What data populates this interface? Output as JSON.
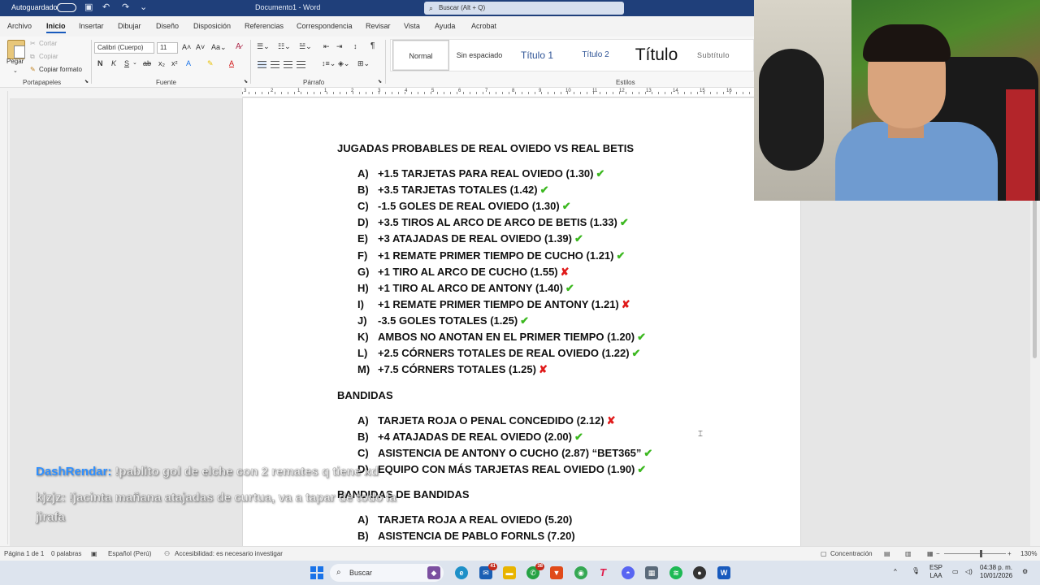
{
  "titlebar": {
    "autosave": "Autoguardado",
    "document_title": "Documento1 - Word",
    "search_placeholder": "Buscar (Alt + Q)"
  },
  "menu": {
    "tabs": [
      "Archivo",
      "Inicio",
      "Insertar",
      "Dibujar",
      "Diseño",
      "Disposición",
      "Referencias",
      "Correspondencia",
      "Revisar",
      "Vista",
      "Ayuda",
      "Acrobat"
    ],
    "active": "Inicio"
  },
  "ribbon": {
    "clipboard": {
      "paste": "Pegar",
      "cut": "Cortar",
      "copy": "Copiar",
      "format_painter": "Copiar formato",
      "label": "Portapapeles"
    },
    "font": {
      "name": "Calibri (Cuerpo)",
      "size": "11",
      "label": "Fuente"
    },
    "paragraph": {
      "label": "Párrafo"
    },
    "styles": {
      "label": "Estilos",
      "items": [
        "Normal",
        "Sin espaciado",
        "Título 1",
        "Título 2",
        "Título",
        "Subtítulo"
      ]
    }
  },
  "ruler": {
    "numbers": [
      "3",
      "2",
      "1",
      "1",
      "2",
      "3",
      "4",
      "5",
      "6",
      "7",
      "8",
      "9",
      "10",
      "11",
      "12",
      "13",
      "14",
      "15",
      "16"
    ]
  },
  "document": {
    "heading1": "JUGADAS PROBABLES DE REAL OVIEDO VS REAL BETIS",
    "list1": [
      {
        "letter": "A)",
        "text": "+1.5 TARJETAS PARA REAL OVIEDO (1.30)",
        "mark": "✔",
        "status": "ok"
      },
      {
        "letter": "B)",
        "text": "+3.5 TARJETAS TOTALES (1.42)",
        "mark": "✔",
        "status": "ok"
      },
      {
        "letter": "C)",
        "text": "-1.5 GOLES DE REAL OVIEDO (1.30)",
        "mark": "✔",
        "status": "ok"
      },
      {
        "letter": "D)",
        "text": "+3.5 TIROS AL ARCO DE ARCO DE BETIS (1.33)",
        "mark": "✔",
        "status": "ok"
      },
      {
        "letter": "E)",
        "text": "+3 ATAJADAS DE REAL OVIEDO (1.39)",
        "mark": "✔",
        "status": "ok"
      },
      {
        "letter": "F)",
        "text": "+1 REMATE PRIMER TIEMPO DE CUCHO (1.21)",
        "mark": "✔",
        "status": "ok"
      },
      {
        "letter": "G)",
        "text": "+1 TIRO AL ARCO DE CUCHO (1.55)",
        "mark": "✘",
        "status": "bad"
      },
      {
        "letter": "H)",
        "text": "+1 TIRO AL ARCO DE ANTONY (1.40)",
        "mark": "✔",
        "status": "ok"
      },
      {
        "letter": "I)",
        "text": "+1 REMATE PRIMER TIEMPO DE ANTONY (1.21)",
        "mark": "✘",
        "status": "bad"
      },
      {
        "letter": "J)",
        "text": "-3.5 GOLES TOTALES (1.25)",
        "mark": "✔",
        "status": "ok"
      },
      {
        "letter": "K)",
        "text": "AMBOS NO ANOTAN EN EL PRIMER TIEMPO (1.20)",
        "mark": "✔",
        "status": "ok"
      },
      {
        "letter": "L)",
        "text": "+2.5 CÓRNERS TOTALES DE REAL OVIEDO (1.22)",
        "mark": "✔",
        "status": "ok"
      },
      {
        "letter": "M)",
        "text": "+7.5 CÓRNERS TOTALES (1.25)",
        "mark": "✘",
        "status": "bad"
      }
    ],
    "heading2": "BANDIDAS",
    "list2": [
      {
        "letter": "A)",
        "text": "TARJETA ROJA O PENAL CONCEDIDO (2.12)",
        "mark": "✘",
        "status": "bad"
      },
      {
        "letter": "B)",
        "text": "+4 ATAJADAS DE REAL OVIEDO (2.00)",
        "mark": "✔",
        "status": "ok"
      },
      {
        "letter": "C)",
        "text": "ASISTENCIA DE ANTONY O CUCHO (2.87) “BET365”",
        "mark": "✔",
        "status": "ok"
      },
      {
        "letter": "D)",
        "text": "EQUIPO CON MÁS TARJETAS REAL OVIEDO (1.90)",
        "mark": "✔",
        "status": "ok"
      }
    ],
    "heading3": "BANDIDAS DE BANDIDAS",
    "list3": [
      {
        "letter": "A)",
        "text": "TARJETA ROJA A REAL OVIEDO (5.20)"
      },
      {
        "letter": "B)",
        "text": "ASISTENCIA DE PABLO FORNLS (7.20)"
      }
    ]
  },
  "chat": [
    {
      "user": "DashRendar:",
      "message": "!pablito gol de elche con 2 remates q tiene xd"
    },
    {
      "user": "kjzjz:",
      "message": "!jacinta mañana atajadas de curtua, va a tapar de todo la",
      "continuation": "jirafa"
    }
  ],
  "statusbar": {
    "page": "Página 1 de 1",
    "words": "0 palabras",
    "language": "Español (Perú)",
    "accessibility": "Accesibilidad: es necesario investigar",
    "focus": "Concentración",
    "zoom": "130%",
    "zoom_level_percent": 130
  },
  "taskbar": {
    "search": "Buscar",
    "language_top": "ESP",
    "language_bottom": "LAA",
    "time": "04:38 p. m.",
    "date": "10/01/2026",
    "badges": {
      "mail": "41",
      "whatsapp": "38"
    }
  },
  "colors": {
    "ok": "#3cb820",
    "bad": "#e01b1b",
    "accent": "#185abd",
    "titlebar": "#1f3f7a",
    "chat_user": "#2e8fff"
  }
}
